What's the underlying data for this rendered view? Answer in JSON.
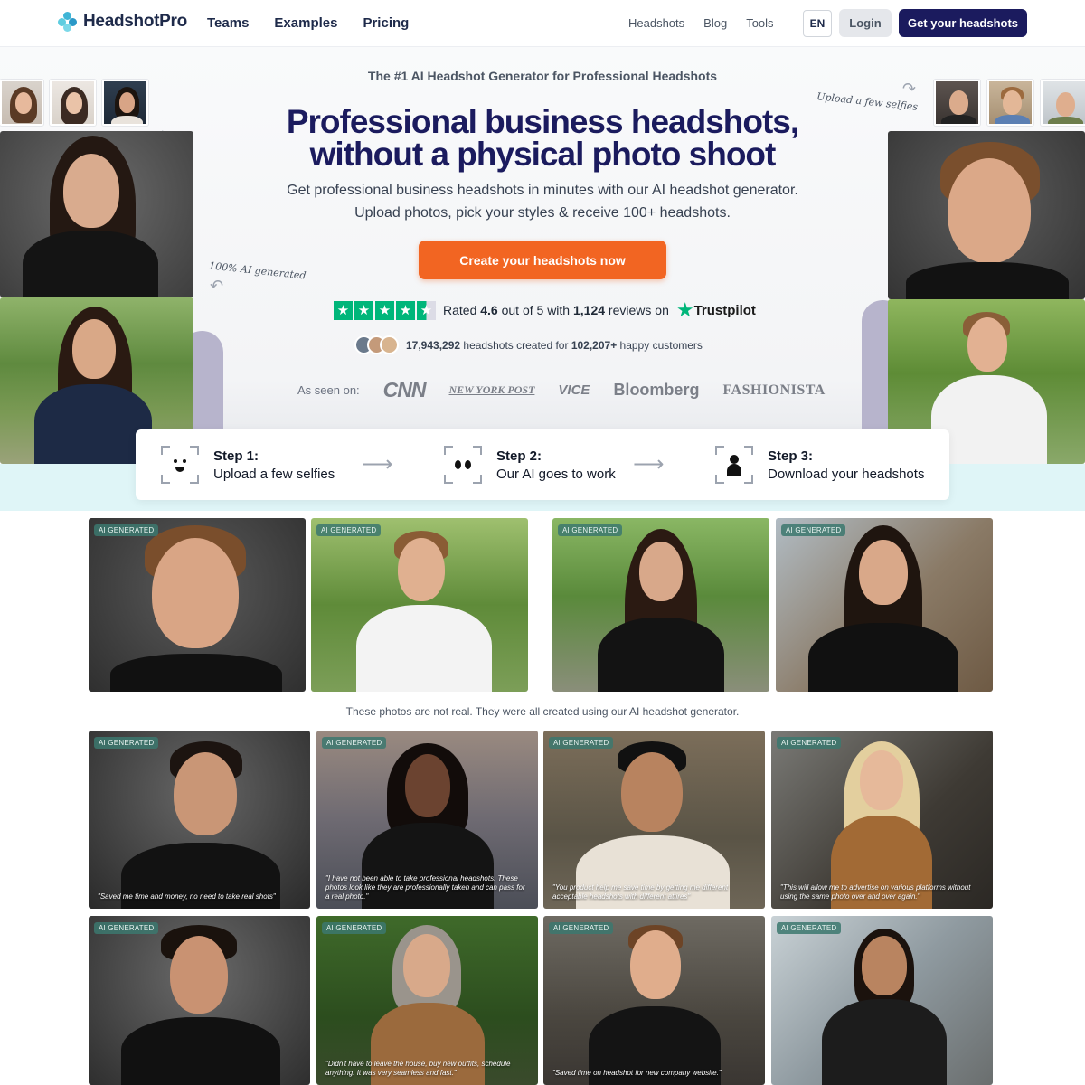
{
  "nav": {
    "logo": "HeadshotPro",
    "main_links": [
      "Teams",
      "Examples",
      "Pricing"
    ],
    "right_links": [
      "Headshots",
      "Blog",
      "Tools"
    ],
    "lang": "EN",
    "login": "Login",
    "cta": "Get your headshots"
  },
  "hero": {
    "tagline": "The #1 AI Headshot Generator for Professional Headshots",
    "headline_line1": "Professional business headshots,",
    "headline_line2": "without a physical photo shoot",
    "subline": "Get professional business headshots in minutes with our AI headshot generator. Upload photos, pick your styles & receive 100+ headshots.",
    "cta": "Create your headshots now",
    "rating_pre": "Rated ",
    "rating_value": "4.6",
    "rating_mid": " out of 5 with ",
    "review_count": "1,124",
    "rating_post": " reviews on",
    "trustpilot": "Trustpilot",
    "headshots_count": "17,943,292",
    "headshots_mid": " headshots created for ",
    "customers_count": "102,207+",
    "customers_post": " happy customers",
    "seen_label": "As seen on:",
    "press": [
      "CNN",
      "NEW YORK POST",
      "VICE",
      "Bloomberg",
      "FASHIONISTA"
    ],
    "note_left": "100% AI generated",
    "note_right": "Upload a few selfies"
  },
  "steps": [
    {
      "title": "Step 1:",
      "desc": "Upload a few selfies"
    },
    {
      "title": "Step 2:",
      "desc": "Our AI goes to work"
    },
    {
      "title": "Step 3:",
      "desc": "Download your headshots"
    }
  ],
  "gallery": {
    "badge": "AI GENERATED",
    "note": "These photos are not real. They were all created using our AI headshot generator.",
    "quotes": [
      "\"Saved me time and money, no need to take real shots\"",
      "\"I have not been able to take professional headshots. These photos look like they are professionally taken and can pass for a real photo.\"",
      "\"You product help me save time by getting me different acceptable headshots with different attires\"",
      "\"This will allow me to advertise on various platforms without using the same photo over and over again.\"",
      "",
      "\"Didn't have to leave the house, buy new outfits, schedule anything. It was very seamless and fast.\"",
      "\"Saved time on headshot for new company website.\"",
      ""
    ]
  },
  "colors": {
    "brand_navy": "#1b1b5e",
    "cta_orange": "#f26522",
    "trustpilot_green": "#00b67a",
    "steps_band": "#dff5f7"
  }
}
